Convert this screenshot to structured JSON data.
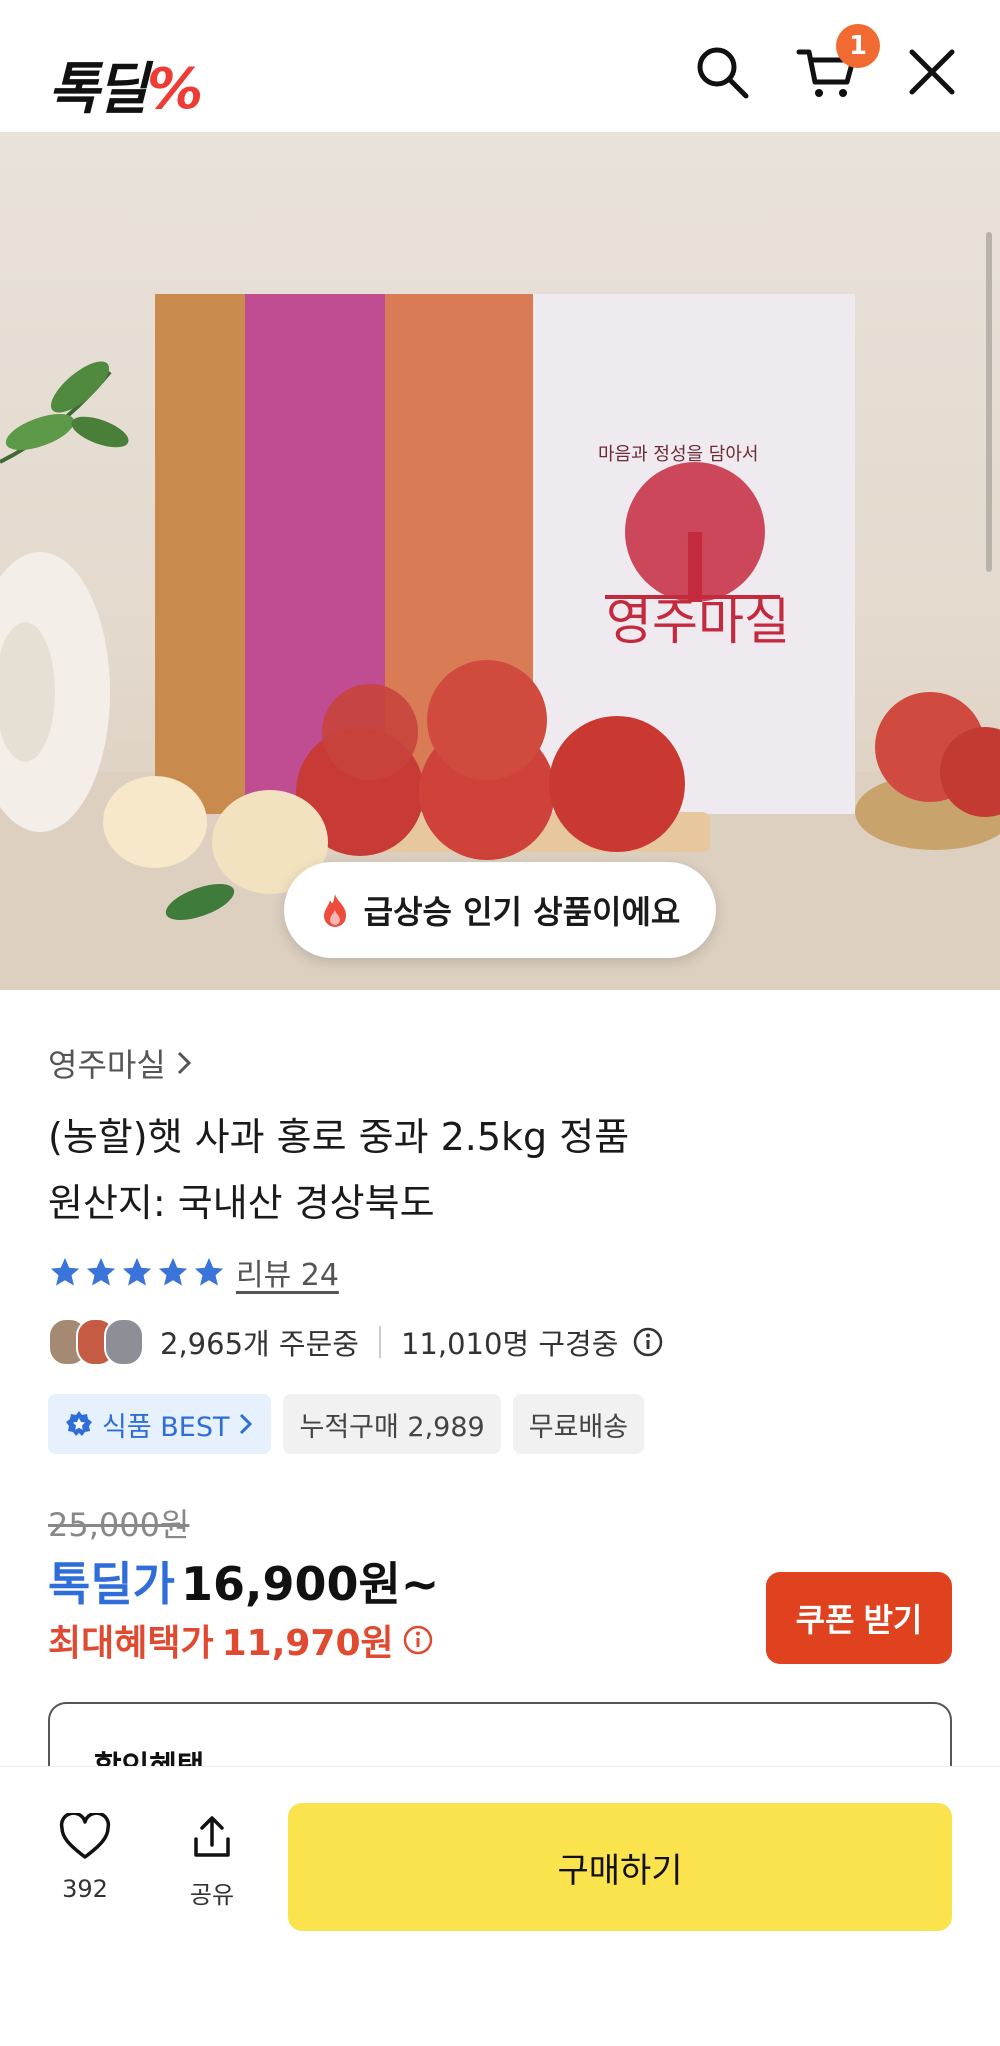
{
  "header": {
    "logo_text": "톡딜",
    "logo_symbol": "%",
    "cart_count": "1"
  },
  "hero": {
    "box_caption": "마음과 정성을 담아서",
    "box_brand": "영주마실",
    "popular_badge": "급상승 인기 상품이에요"
  },
  "product": {
    "brand": "영주마실",
    "title_line1": "(농할)햇 사과 홍로 중과 2.5kg 정품",
    "title_line2": "원산지: 국내산 경상북도",
    "review_label": "리뷰 24",
    "rating_stars": 5,
    "orders": "2,965개 주문중",
    "viewers": "11,010명 구경중",
    "tags": {
      "best": "식품 BEST",
      "cumulative": "누적구매 2,989",
      "shipping": "무료배송"
    },
    "original_price": "25,000원",
    "price_label": "톡딜가",
    "price": "16,900원~",
    "benefit_label": "최대혜택가",
    "benefit_price": "11,970원",
    "coupon_button": "쿠폰 받기",
    "discount_section_title": "할인혜택"
  },
  "bottom_bar": {
    "like_count": "392",
    "share_label": "공유",
    "buy_button": "구매하기"
  },
  "colors": {
    "brand_blue": "#2f6ed9",
    "benefit_red": "#e04a30",
    "coupon_red": "#e0421f",
    "buy_yellow": "#fae34d",
    "badge_orange": "#f06a31"
  }
}
